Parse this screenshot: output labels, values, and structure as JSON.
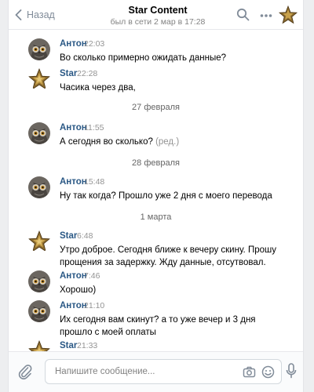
{
  "header": {
    "back_label": "Назад",
    "title": "Star Content",
    "subtitle": "был в сети 2 мар в 17:28"
  },
  "messages": [
    {
      "author": "Антон",
      "time": "22:03",
      "avatar": "owl-avatar",
      "text": "Во сколько примерно ожидать данные?"
    },
    {
      "author": "Star",
      "time": "22:28",
      "avatar": "star-avatar",
      "text": "Часика через два,"
    },
    {
      "date": "27 февраля"
    },
    {
      "author": "Антон",
      "time": "11:55",
      "avatar": "owl-avatar",
      "text": "А сегодня во сколько?",
      "edited": "(ред.)"
    },
    {
      "date": "28 февраля"
    },
    {
      "author": "Антон",
      "time": "15:48",
      "avatar": "owl-avatar",
      "text": "Ну так когда? Прошло уже 2 дня с моего перевода"
    },
    {
      "date": "1 марта"
    },
    {
      "author": "Star",
      "time": "6:48",
      "avatar": "star-avatar",
      "text": "Утро доброе. Сегодня ближе к вечеру скину. Прошу прощения за задержку. Жду данные, отсутвовал."
    },
    {
      "author": "Антон",
      "time": "7:46",
      "avatar": "owl-avatar",
      "text": "Хорошо)"
    },
    {
      "author": "Антон",
      "time": "21:10",
      "avatar": "owl-avatar",
      "text": "Их сегодня вам скинут? а то уже вечер и 3 дня прошло с моей оплаты"
    },
    {
      "author": "Star",
      "time": "21:33",
      "avatar": "star-avatar",
      "text": ""
    }
  ],
  "composer": {
    "placeholder": "Напишите сообщение..."
  },
  "colors": {
    "accent_link": "#2a5885",
    "icon_gray": "#818c99",
    "background": "#edeef0"
  }
}
